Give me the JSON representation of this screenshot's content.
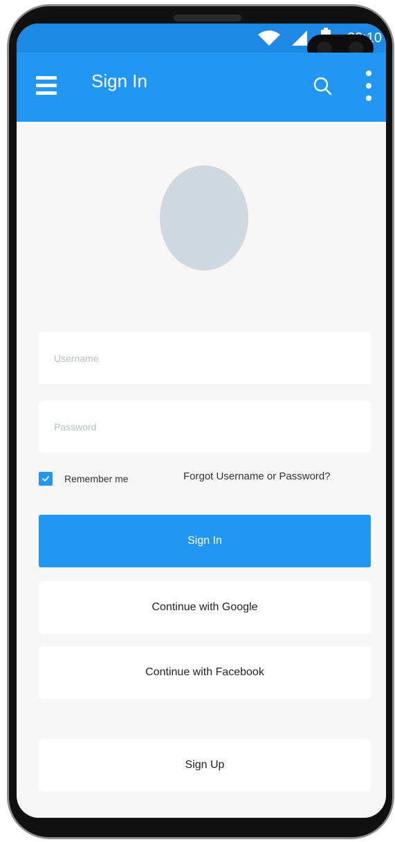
{
  "status_bar": {
    "time": "22:10",
    "icons": [
      "wifi-icon",
      "signal-icon",
      "battery-icon"
    ]
  },
  "app_bar": {
    "title": "Sign In",
    "icons": [
      "menu-icon",
      "search-icon",
      "more-vert-icon"
    ]
  },
  "form": {
    "username_placeholder": "Username",
    "password_placeholder": "Password",
    "remember_label": "Remember me",
    "remember_checked": true,
    "forgot_link": "Forgot Username or Password?"
  },
  "buttons": {
    "sign_in": "Sign In",
    "google": "Continue with Google",
    "facebook": "Continue with Facebook",
    "sign_up": "Sign Up"
  },
  "colors": {
    "primary": "#2196f3",
    "status_bar": "#1e88e5",
    "background": "#f6f6f6",
    "avatar": "#cfd8de"
  }
}
